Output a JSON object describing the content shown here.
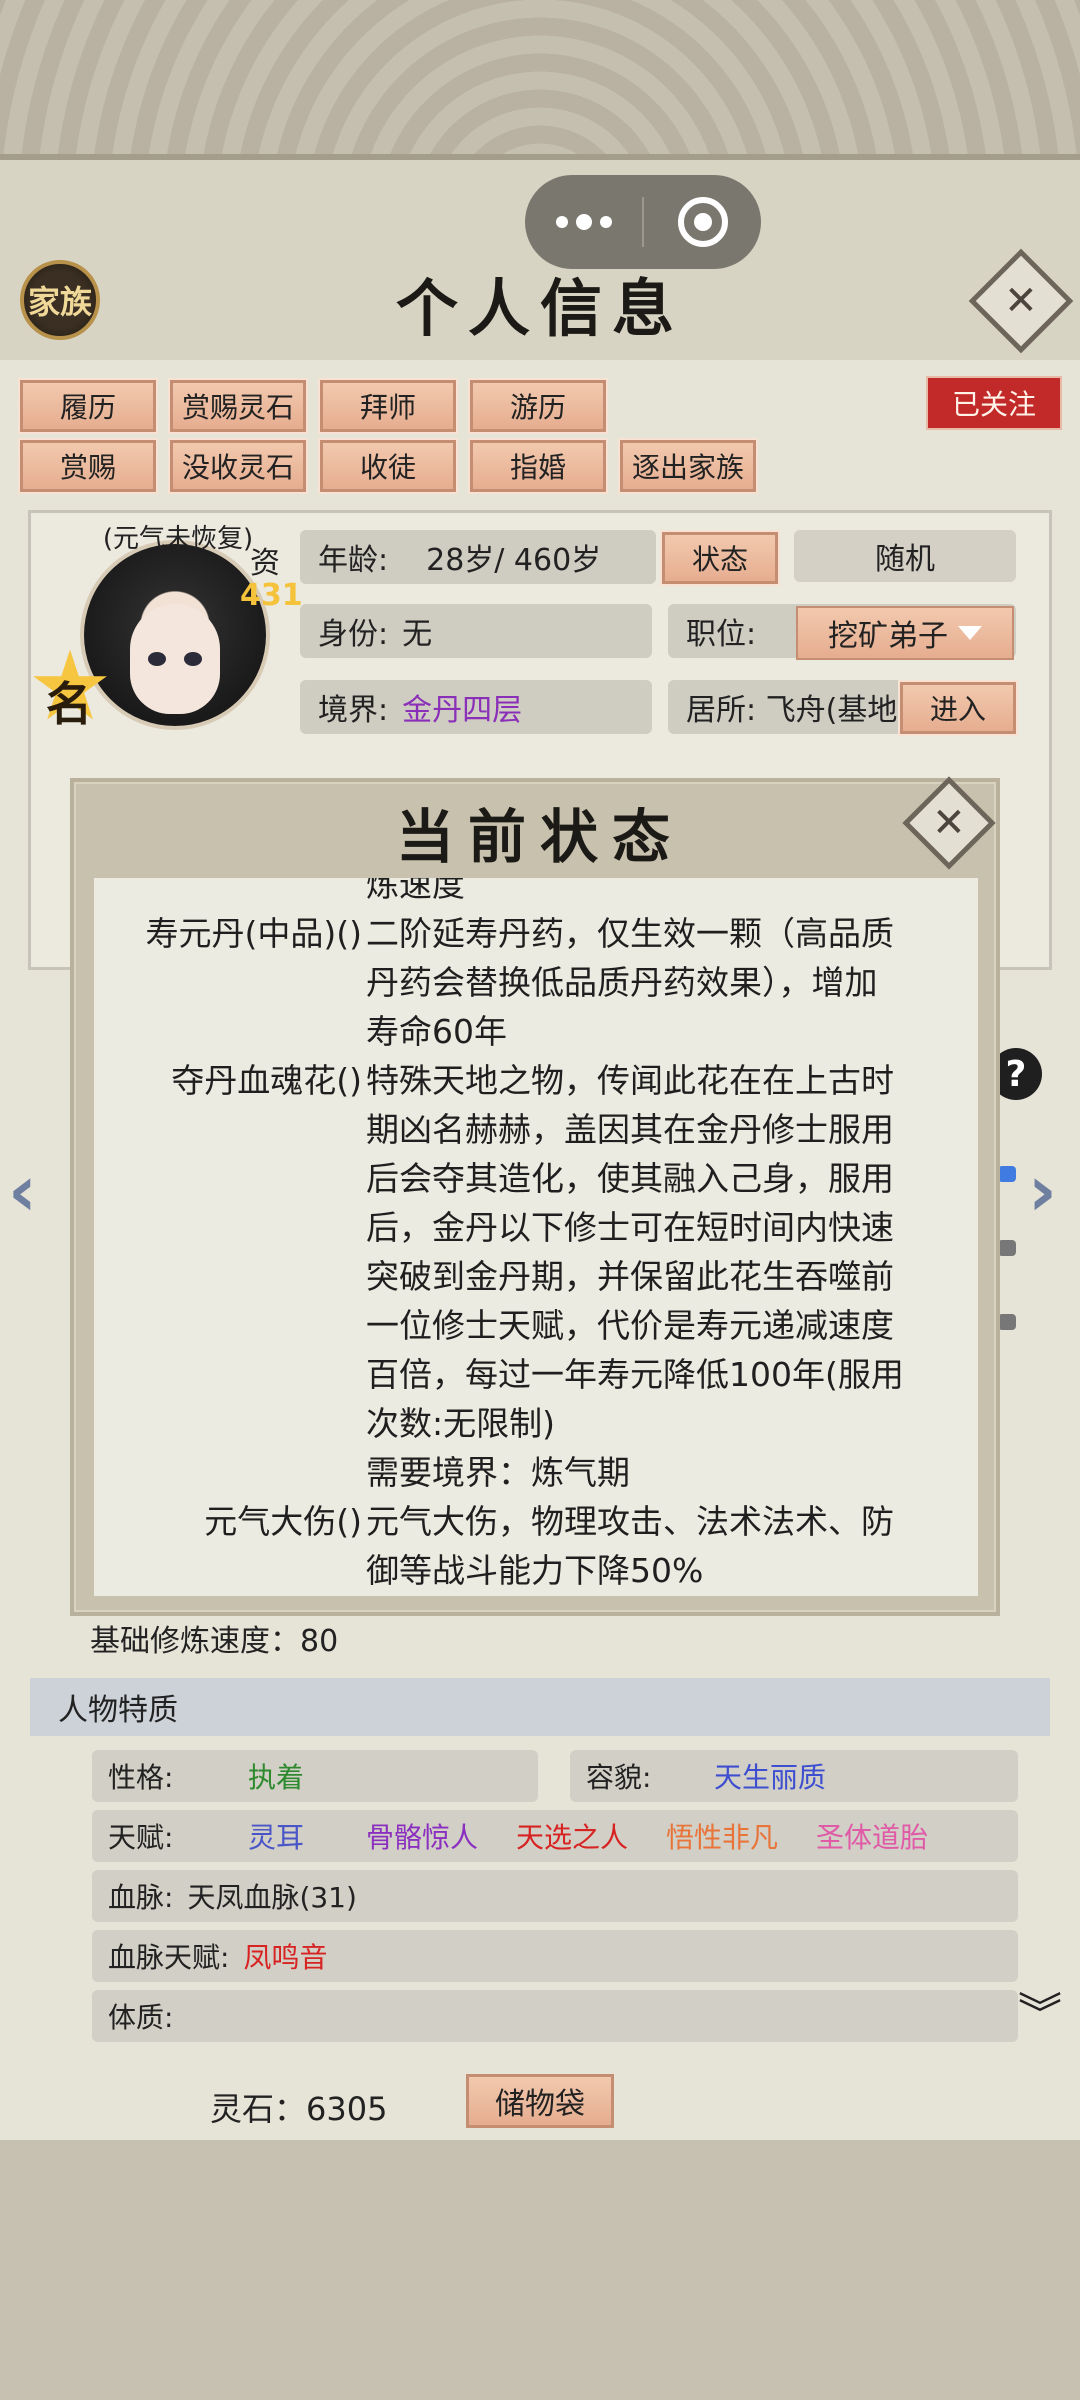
{
  "header": {
    "family_label": "家族",
    "title": "个人信息"
  },
  "actions": {
    "row1": [
      "履历",
      "赏赐灵石",
      "拜师",
      "游历"
    ],
    "row2": [
      "赏赐",
      "没收灵石",
      "收徒",
      "指婚",
      "逐出家族"
    ],
    "follow_label": "已关注"
  },
  "profile": {
    "avatar_note": "(元气未恢复)",
    "talent_label": "资",
    "talent_value": "431",
    "badge_label": "名",
    "age_label": "年龄:",
    "age_value": "28岁/ 460岁",
    "status_button": "状态",
    "random_button": "随机",
    "identity_label": "身份:",
    "identity_value": "无",
    "position_label": "职位:",
    "position_value": "挖矿弟子",
    "realm_label": "境界:",
    "realm_value": "金丹四层",
    "residence_label": "居所: 飞舟(基地",
    "enter_button": "进入"
  },
  "modal": {
    "title": "当前状态",
    "cut_top": "炼速度",
    "items": [
      {
        "name": "寿元丹(中品)()",
        "lines": [
          "二阶延寿丹药，仅生效一颗（高品质",
          "丹药会替换低品质丹药效果），增加",
          "寿命60年"
        ]
      },
      {
        "name": "夺丹血魂花()",
        "lines": [
          "特殊天地之物，传闻此花在在上古时",
          "期凶名赫赫，盖因其在金丹修士服用",
          "后会夺其造化，使其融入己身，服用",
          "后，金丹以下修士可在短时间内快速",
          "突破到金丹期，并保留此花生吞噬前",
          "一位修士天赋，代价是寿元递减速度",
          "百倍，每过一年寿元降低100年(服用",
          "次数:无限制)",
          "需要境界：炼气期"
        ]
      },
      {
        "name": "元气大伤()",
        "lines": [
          "元气大伤，物理攻击、法术法术、防",
          "御等战斗能力下降50%"
        ]
      }
    ]
  },
  "details": {
    "base_speed": "基础修炼速度：80",
    "traits_header": "人物特质",
    "personality_label": "性格:",
    "personality_value": "执着",
    "looks_label": "容貌:",
    "looks_value": "天生丽质",
    "gift_label": "天赋:",
    "gifts": [
      {
        "text": "灵耳",
        "color": "#4a55c8"
      },
      {
        "text": "骨骼惊人",
        "color": "#8b2fc0"
      },
      {
        "text": "天选之人",
        "color": "#d82323"
      },
      {
        "text": "悟性非凡",
        "color": "#e8743a"
      },
      {
        "text": "圣体道胎",
        "color": "#e05aa8"
      }
    ],
    "bloodline_label": "血脉:",
    "bloodline_value": "天凤血脉(31)",
    "bloodline_gift_label": "血脉天赋:",
    "bloodline_gift_value": "凤鸣音",
    "physique_label": "体质:"
  },
  "footer": {
    "spirit_stone": "灵石：6305",
    "storage_button": "储物袋"
  },
  "colors": {
    "realm": "#8a2fb8",
    "personality": "#2f8a2f",
    "looks": "#3d4fd0",
    "bloodline_gift": "#d82323"
  }
}
